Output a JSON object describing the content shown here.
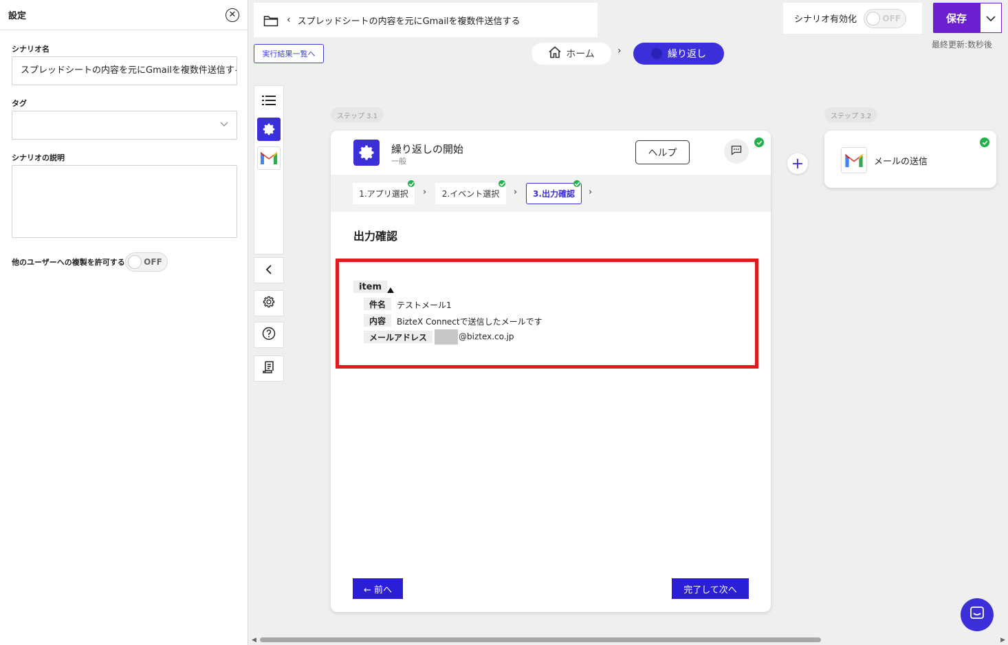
{
  "settings_panel": {
    "title": "設定",
    "scenario_name_label": "シナリオ名",
    "scenario_name_value": "スプレッドシートの内容を元にGmailを複数件送信する",
    "tag_label": "タグ",
    "description_label": "シナリオの説明",
    "allow_copy_label": "他のユーザーへの複製を許可する",
    "allow_copy_toggle": "OFF"
  },
  "header": {
    "scenario_title": "スプレッドシートの内容を元にGmailを複数件送信する",
    "results_link": "実行結果一覧へ",
    "home_crumb": "ホーム",
    "loop_crumb": "繰り返し",
    "enable_label": "シナリオ有効化",
    "enable_toggle": "OFF",
    "save_label": "保存",
    "last_update": "最終更新:数秒後"
  },
  "steps": {
    "step1_label": "ステップ  3.1",
    "step2_label": "ステップ  3.2"
  },
  "card": {
    "title": "繰り返しの開始",
    "subtitle": "一般",
    "help_label": "ヘルプ",
    "tabs": [
      {
        "label": "1.アプリ選択"
      },
      {
        "label": "2.イベント選択"
      },
      {
        "label": "3.出力確認"
      }
    ],
    "section_title": "出力確認",
    "output": {
      "root_key": "item",
      "rows": [
        {
          "key": "件名",
          "value": "テストメール1"
        },
        {
          "key": "内容",
          "value": "BizteX Connectで送信したメールです"
        },
        {
          "key": "メールアドレス",
          "value": "@biztex.co.jp"
        }
      ]
    },
    "prev_label": "← 前へ",
    "next_label": "完了して次へ"
  },
  "next_step": {
    "title": "メールの送信"
  },
  "colors": {
    "accent": "#3a2fd8",
    "save": "#6a1fd0",
    "highlight": "#e01b1b",
    "success": "#22b14c"
  }
}
